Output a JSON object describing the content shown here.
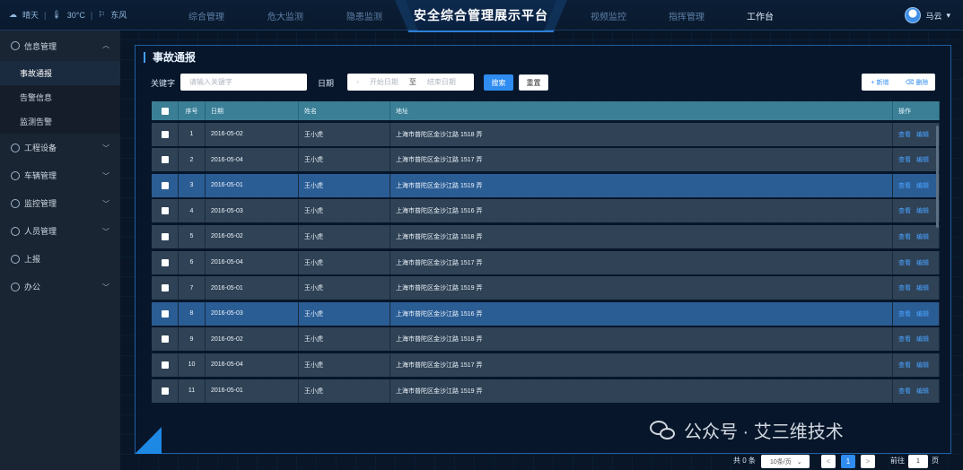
{
  "header": {
    "weather": "晴天",
    "temperature": "30°C",
    "wind": "东风",
    "title": "安全综合管理展示平台",
    "nav_left": [
      "综合管理",
      "危大监测",
      "隐患监测"
    ],
    "nav_right": [
      "视频监控",
      "指挥管理",
      "工作台"
    ],
    "active_nav": "工作台",
    "user_name": "马云"
  },
  "sidebar": {
    "groups": [
      {
        "label": "信息管理",
        "chevron": "up",
        "children": [
          "事故通报",
          "告警信息",
          "监测告警"
        ],
        "active_child": "事故通报"
      },
      {
        "label": "工程设备",
        "chevron": "down"
      },
      {
        "label": "车辆管理",
        "chevron": "down"
      },
      {
        "label": "监控管理",
        "chevron": "down"
      },
      {
        "label": "人员管理",
        "chevron": "down"
      },
      {
        "label": "上报",
        "chevron": ""
      },
      {
        "label": "办公",
        "chevron": "down"
      }
    ]
  },
  "panel": {
    "title": "事故通报",
    "keyword_label": "关键字",
    "keyword_placeholder": "请输入关键字",
    "date_label": "日期",
    "start_placeholder": "开始日期",
    "date_sep": "至",
    "end_placeholder": "结束日期",
    "search_btn": "搜索",
    "reset_btn": "重置",
    "add_btn": "+ 新增",
    "delete_btn": "删除"
  },
  "table": {
    "headers": [
      "",
      "序号",
      "日期",
      "姓名",
      "地址",
      "操作"
    ],
    "rows": [
      {
        "idx": "1",
        "date": "2016-05-02",
        "name": "王小虎",
        "addr": "上海市普陀区金沙江路 1518 弄",
        "highlight": false
      },
      {
        "idx": "2",
        "date": "2016-05-04",
        "name": "王小虎",
        "addr": "上海市普陀区金沙江路 1517 弄",
        "highlight": false
      },
      {
        "idx": "3",
        "date": "2016-05-01",
        "name": "王小虎",
        "addr": "上海市普陀区金沙江路 1519 弄",
        "highlight": true
      },
      {
        "idx": "4",
        "date": "2016-05-03",
        "name": "王小虎",
        "addr": "上海市普陀区金沙江路 1516 弄",
        "highlight": false
      },
      {
        "idx": "5",
        "date": "2016-05-02",
        "name": "王小虎",
        "addr": "上海市普陀区金沙江路 1518 弄",
        "highlight": false
      },
      {
        "idx": "6",
        "date": "2016-05-04",
        "name": "王小虎",
        "addr": "上海市普陀区金沙江路 1517 弄",
        "highlight": false
      },
      {
        "idx": "7",
        "date": "2016-05-01",
        "name": "王小虎",
        "addr": "上海市普陀区金沙江路 1519 弄",
        "highlight": false
      },
      {
        "idx": "8",
        "date": "2016-05-03",
        "name": "王小虎",
        "addr": "上海市普陀区金沙江路 1516 弄",
        "highlight": true
      },
      {
        "idx": "9",
        "date": "2016-05-02",
        "name": "王小虎",
        "addr": "上海市普陀区金沙江路 1518 弄",
        "highlight": false
      },
      {
        "idx": "10",
        "date": "2016-05-04",
        "name": "王小虎",
        "addr": "上海市普陀区金沙江路 1517 弄",
        "highlight": false
      },
      {
        "idx": "11",
        "date": "2016-05-01",
        "name": "王小虎",
        "addr": "上海市普陀区金沙江路 1519 弄",
        "highlight": false
      }
    ],
    "op_view": "查看",
    "op_edit": "编辑"
  },
  "pagination": {
    "total": "共 0 条",
    "page_size": "10条/页",
    "prev": "<",
    "current": "1",
    "next": ">",
    "goto_label": "前往",
    "goto_value": "1",
    "page_unit": "页"
  },
  "watermark": "公众号 · 艾三维技术",
  "colors": {
    "accent": "#2f8cf0",
    "header_row": "#3a7f95",
    "row": "#2f4256",
    "row_highlight": "#2b5d95",
    "sidebar": "#1a2533"
  }
}
